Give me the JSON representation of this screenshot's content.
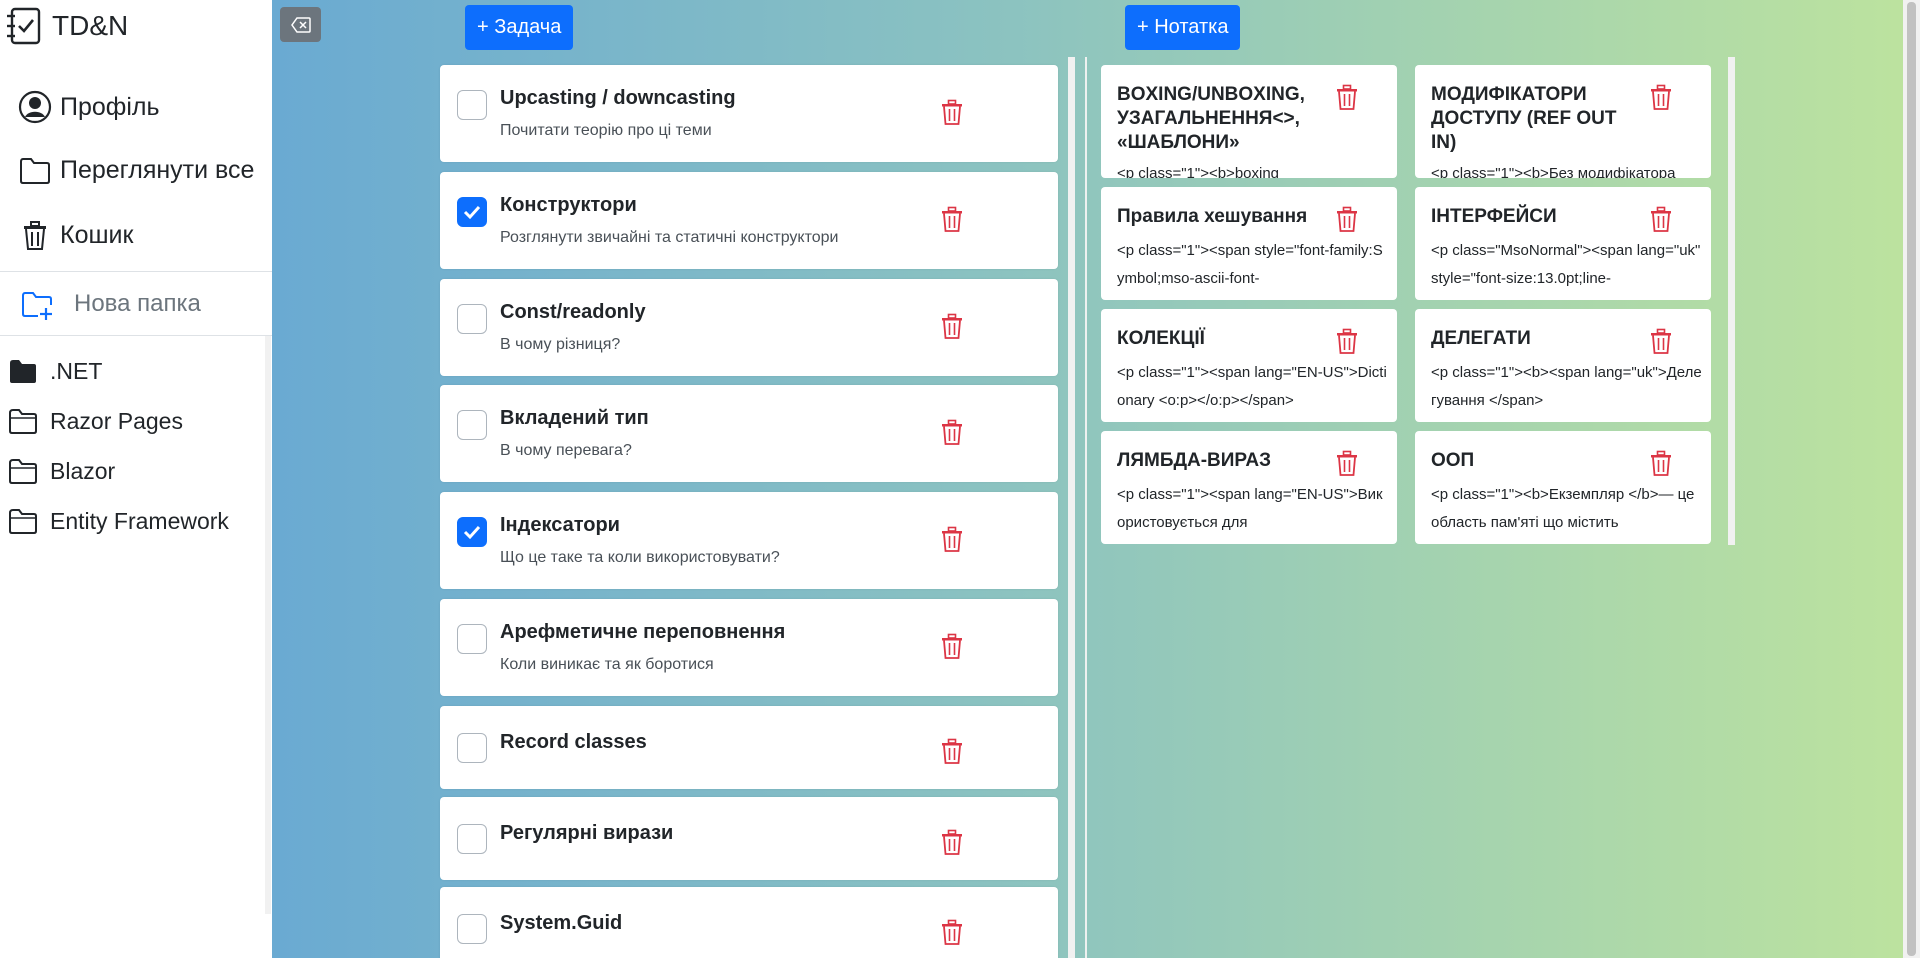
{
  "app": {
    "title": "TD&N"
  },
  "nav": {
    "profile": "Профіль",
    "view_all": "Переглянути все",
    "trash": "Кошик"
  },
  "new_folder": {
    "label": "Нова папка"
  },
  "folders": [
    ".NET",
    "Razor Pages",
    "Blazor",
    "Entity Framework"
  ],
  "toolbar": {
    "add_task": "+ Задача",
    "add_note": "+ Нотатка"
  },
  "tasks": [
    {
      "title": "Upcasting / downcasting",
      "desc": "Почитати теорію про ці теми",
      "done": false
    },
    {
      "title": "Конструктори",
      "desc": "Розглянути звичайні та статичні конструктори",
      "done": true
    },
    {
      "title": "Const/readonly",
      "desc": "В чому різниця?",
      "done": false
    },
    {
      "title": "Вкладений тип",
      "desc": "В чому перевага?",
      "done": false
    },
    {
      "title": "Індексатори",
      "desc": "Що це таке та коли використовувати?",
      "done": true
    },
    {
      "title": "Арефметичне переповнення",
      "desc": "Коли виникає та як боротися",
      "done": false
    },
    {
      "title": "Record classes",
      "desc": "",
      "done": false
    },
    {
      "title": "Регулярні вирази",
      "desc": "",
      "done": false
    },
    {
      "title": "System.Guid",
      "desc": "",
      "done": false
    }
  ],
  "notes": [
    {
      "title": "BOXING/UNBOXING, УЗАГАЛЬНЕННЯ<>, «ШАБЛОНИ»",
      "body": "<p class=\"1\"><b>boxing"
    },
    {
      "title": "МОДИФІКАТОРИ ДОСТУПУ (REF OUT IN)",
      "body": "<p class=\"1\"><b>Без модифікатора"
    },
    {
      "title": "Правила хешування",
      "body": "<p class=\"1\"><span style=\"font-family:Symbol;mso-ascii-font-"
    },
    {
      "title": "ІНТЕРФЕЙСИ",
      "body": "<p class=\"MsoNormal\"><span lang=\"uk\" style=\"font-size:13.0pt;line-"
    },
    {
      "title": "КОЛЕКЦІЇ",
      "body": "<p class=\"1\"><span lang=\"EN-US\">Dictionary <o:p></o:p></span>"
    },
    {
      "title": "ДЕЛЕГАТИ",
      "body": "<p class=\"1\"><b><span lang=\"uk\">Делегування </span>"
    },
    {
      "title": "ЛЯМБДА-ВИРАЗ",
      "body": "<p class=\"1\"><span lang=\"EN-US\">Використовується для"
    },
    {
      "title": "ООП",
      "body": "<p class=\"1\"><b>Екземпляр </b>— це область пам'яті що містить"
    }
  ],
  "colors": {
    "primary": "#0d6efd",
    "danger": "#dc3545",
    "secondary": "#6c757d",
    "gradient_start": "#6aaad2",
    "gradient_end": "#bde39e"
  }
}
